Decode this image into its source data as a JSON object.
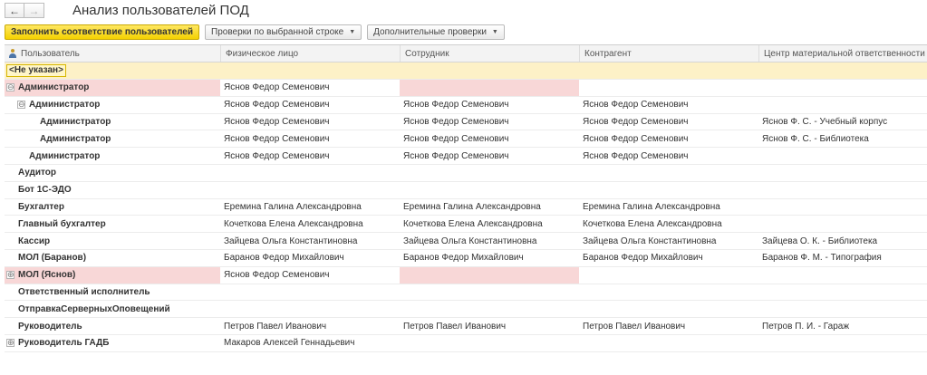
{
  "window": {
    "title": "Анализ пользователей ПОД",
    "back_icon": "←",
    "forward_icon": "→"
  },
  "toolbar": {
    "fill_label": "Заполнить соответствие пользователей",
    "check_selected_label": "Проверки по выбранной строке",
    "additional_checks_label": "Дополнительные проверки",
    "dropdown_icon": "▼"
  },
  "table": {
    "columns": [
      "Пользователь",
      "Физическое лицо",
      "Сотрудник",
      "Контрагент",
      "Центр материальной ответственности"
    ],
    "rows": [
      {
        "user": "<Не указан>",
        "person": "",
        "employee": "",
        "contractor": "",
        "mrc": ""
      },
      {
        "user": "Администратор",
        "person": "Яснов Федор Семенович",
        "employee": "",
        "contractor": "",
        "mrc": "",
        "toggle": "⊖"
      },
      {
        "user": "Администратор",
        "person": "Яснов Федор Семенович",
        "employee": "Яснов Федор Семенович",
        "contractor": "Яснов Федор Семенович",
        "mrc": "",
        "toggle": "⊖"
      },
      {
        "user": "Администратор",
        "person": "Яснов Федор Семенович",
        "employee": "Яснов Федор Семенович",
        "contractor": "Яснов Федор Семенович",
        "mrc": "Яснов Ф. С. - Учебный корпус"
      },
      {
        "user": "Администратор",
        "person": "Яснов Федор Семенович",
        "employee": "Яснов Федор Семенович",
        "contractor": "Яснов Федор Семенович",
        "mrc": "Яснов Ф. С. - Библиотека"
      },
      {
        "user": "Администратор",
        "person": "Яснов Федор Семенович",
        "employee": "Яснов Федор Семенович",
        "contractor": "Яснов Федор Семенович",
        "mrc": ""
      },
      {
        "user": "Аудитор",
        "person": "",
        "employee": "",
        "contractor": "",
        "mrc": ""
      },
      {
        "user": "Бот 1С-ЭДО",
        "person": "",
        "employee": "",
        "contractor": "",
        "mrc": ""
      },
      {
        "user": "Бухгалтер",
        "person": "Еремина Галина Александровна",
        "employee": "Еремина Галина Александровна",
        "contractor": "Еремина Галина Александровна",
        "mrc": ""
      },
      {
        "user": "Главный бухгалтер",
        "person": "Кочеткова Елена Александровна",
        "employee": "Кочеткова Елена Александровна",
        "contractor": "Кочеткова Елена Александровна",
        "mrc": ""
      },
      {
        "user": "Кассир",
        "person": "Зайцева Ольга Константиновна",
        "employee": "Зайцева Ольга Константиновна",
        "contractor": "Зайцева Ольга Константиновна",
        "mrc": "Зайцева О. К. - Библиотека"
      },
      {
        "user": "МОЛ (Баранов)",
        "person": "Баранов Федор Михайлович",
        "employee": "Баранов Федор Михайлович",
        "contractor": "Баранов Федор Михайлович",
        "mrc": "Баранов Ф. М. - Типография"
      },
      {
        "user": "МОЛ (Яснов)",
        "person": "Яснов Федор Семенович",
        "employee": "",
        "contractor": "",
        "mrc": "",
        "toggle": "⊕"
      },
      {
        "user": "Ответственный исполнитель",
        "person": "",
        "employee": "",
        "contractor": "",
        "mrc": ""
      },
      {
        "user": "ОтправкаСерверныхОповещений",
        "person": "",
        "employee": "",
        "contractor": "",
        "mrc": ""
      },
      {
        "user": "Руководитель",
        "person": "Петров Павел Иванович",
        "employee": "Петров Павел Иванович",
        "contractor": "Петров Павел Иванович",
        "mrc": "Петров П. И. - Гараж"
      },
      {
        "user": "Руководитель ГАДБ",
        "person": "Макаров Алексей Геннадьевич",
        "employee": "",
        "contractor": "",
        "mrc": "",
        "toggle": "⊕"
      }
    ]
  }
}
